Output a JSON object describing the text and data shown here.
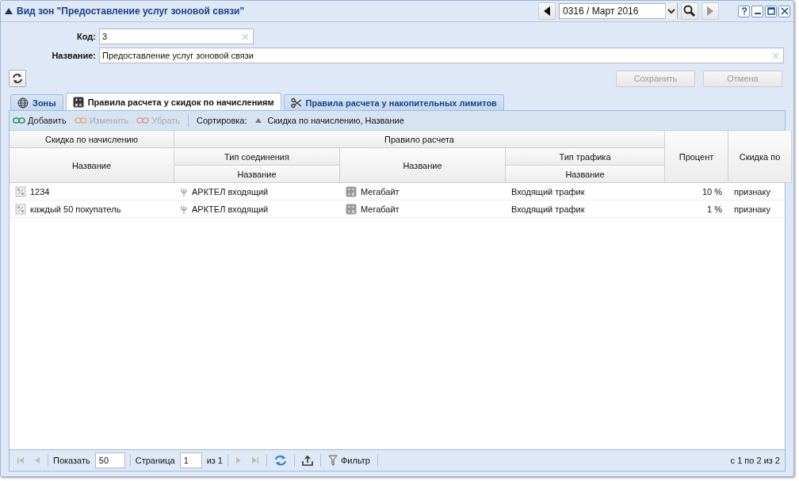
{
  "window": {
    "title": "Вид зон \"Предоставление услуг зоновой связи\"",
    "period": "0316 / Март 2016",
    "next_disabled": true
  },
  "form": {
    "code_label": "Код:",
    "code": "3",
    "name_label": "Название:",
    "name": "Предоставление услуг зоновой связи",
    "save": {
      "label": "Сохранить",
      "disabled": true
    },
    "cancel": {
      "label": "Отмена",
      "disabled": true
    }
  },
  "tabs": [
    {
      "label": "Зоны",
      "kind": "globe",
      "selected": false
    },
    {
      "label": "Правила расчета у скидок по начислениям",
      "kind": "calc",
      "selected": true
    },
    {
      "label": "Правила расчета у накопительных лимитов",
      "kind": "scissors",
      "selected": false
    }
  ],
  "toolbar": {
    "buttons": [
      {
        "label": "Добавить",
        "disabled": false
      },
      {
        "label": "Изменить",
        "disabled": true
      },
      {
        "label": "Убрать",
        "disabled": true
      }
    ],
    "sort_label": "Сортировка:",
    "sort_value": "Скидка по начислению, Название"
  },
  "table": {
    "header_rows": [
      [
        {
          "label": "Скидка по начислению"
        },
        {
          "label": "Правило расчета",
          "colspan": 3
        },
        {
          "label": "Процент",
          "rowspan": 3
        },
        {
          "label": "Скидка по",
          "rowspan": 3
        }
      ],
      [
        {
          "label": "Название",
          "rowspan": 2
        },
        {
          "label": "Тип соединения"
        },
        {
          "label": "Название",
          "rowspan": 2
        },
        {
          "label": "Тип трафика"
        }
      ],
      [
        {
          "label": "Название"
        },
        {
          "label": "Название"
        }
      ]
    ],
    "rows": [
      {
        "cells": [
          "1234",
          "АРКТЕЛ входящий",
          "Мегабайт",
          "Входящий трафик",
          "10 %",
          "признаку"
        ]
      },
      {
        "cells": [
          "каждый 50 покупатель",
          "АРКТЕЛ входящий",
          "Мегабайт",
          "Входящий трафик",
          "1 %",
          "признаку"
        ]
      }
    ]
  },
  "pager": {
    "show_label": "Показать",
    "page_size": "50",
    "page_label": "Страница",
    "page": "1",
    "of": "из 1",
    "filter": "Фильтр",
    "summary": "с 1 по 2 из 2"
  }
}
